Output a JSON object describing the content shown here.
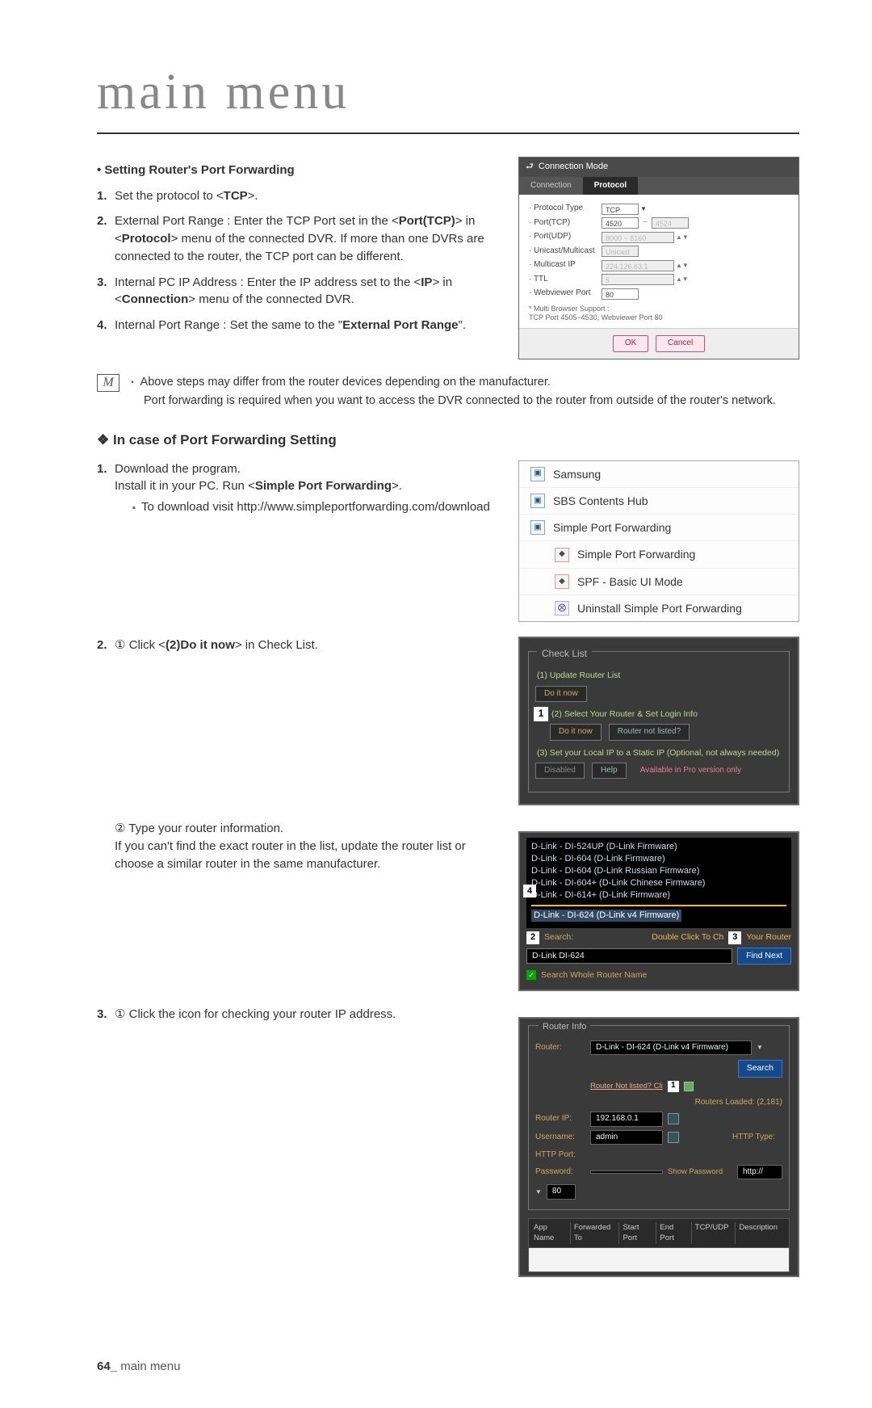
{
  "page": {
    "title": "main menu",
    "footer_page": "64_",
    "footer_text": "main menu"
  },
  "sec1": {
    "heading": "Setting Router's Port Forwarding",
    "steps": [
      {
        "n": "1.",
        "pre": "Set the protocol to <",
        "b": "TCP",
        "post": ">."
      },
      {
        "n": "2.",
        "text": "External Port Range : Enter the TCP Port set in the <",
        "b1": "Port(TCP)",
        "mid": "> in <",
        "b2": "Protocol",
        "post": "> menu of the connected DVR. If more than one DVRs are connected to the router, the TCP port can be different."
      },
      {
        "n": "3.",
        "text": "Internal PC IP Address : Enter the IP address set to the <",
        "b1": "IP",
        "mid": "> in <",
        "b2": "Connection",
        "post": "> menu of the connected DVR."
      },
      {
        "n": "4.",
        "text": "Internal Port Range : Set the same to the \"",
        "b1": "External Port Range",
        "post": "\"."
      }
    ],
    "note_line1": "Above steps may differ from the router devices depending on the manufacturer.",
    "note_line2": "Port forwarding is required when you want to access the DVR connected to the router from outside of the router's network."
  },
  "dialog": {
    "title": "Connection Mode",
    "tabs": {
      "a": "Connection",
      "b": "Protocol"
    },
    "rows": {
      "ptype": {
        "lbl": "Protocol Type",
        "val": "TCP"
      },
      "ptcp": {
        "lbl": "Port(TCP)",
        "a": "4520",
        "b": "4524"
      },
      "pudp": {
        "lbl": "Port(UDP)",
        "a": "8000 ~ 8160"
      },
      "um": {
        "lbl": "Unicast/Multicast",
        "val": "Unicast"
      },
      "mip": {
        "lbl": "Multicast IP",
        "val": "224.126.63.1"
      },
      "ttl": {
        "lbl": "TTL",
        "val": "5"
      },
      "wvp": {
        "lbl": "Webviewer Port",
        "val": "80"
      }
    },
    "note": "* Multi Browser Support :\n   TCP Port 4505~4530, Webviewer Port 80",
    "ok": "OK",
    "cancel": "Cancel"
  },
  "sec2": {
    "heading": "In case of Port Forwarding Setting",
    "s1_n": "1.",
    "s1_a": "Download the program.",
    "s1_b_pre": "Install it in your PC. Run <",
    "s1_b_bold": "Simple Port Forwarding",
    "s1_b_post": ">.",
    "s1_sub": "To download visit http://www.simpleportforwarding.com/download",
    "s2_n": "2.",
    "s2_a_pre": "① Click <",
    "s2_a_bold": "(2)Do it now",
    "s2_a_post": "> in Check List.",
    "s2_b": "② Type your router information.",
    "s2_c": "If you can't find the exact router in the list, update the router list or choose a similar router in the same manufacturer.",
    "s3_n": "3.",
    "s3_a": "① Click the icon for checking your router IP address."
  },
  "menu": {
    "items": [
      {
        "label": "Samsung",
        "icon": "folder"
      },
      {
        "label": "SBS Contents Hub",
        "icon": "folder"
      },
      {
        "label": "Simple Port Forwarding",
        "icon": "folder"
      },
      {
        "label": "Simple Port Forwarding",
        "icon": "spf",
        "indent": true
      },
      {
        "label": "SPF - Basic UI Mode",
        "icon": "spf",
        "indent": true
      },
      {
        "label": "Uninstall Simple Port Forwarding",
        "icon": "un",
        "indent": true
      }
    ]
  },
  "checklist": {
    "legend": "Check List",
    "l1": "(1) Update Router List",
    "b1": "Do it now",
    "l2": "(2) Select Your Router & Set Login Info",
    "b2a": "Do it now",
    "b2b": "Router not listed?",
    "l3": "(3) Set your Local IP to a Static IP (Optional, not always needed)",
    "b3a": "Disabled",
    "b3b": "Help",
    "b3c": "Available in Pro version only"
  },
  "routersel": {
    "items": [
      "D-Link - DI-524UP (D-Link Firmware)",
      "D-Link - DI-604 (D-Link Firmware)",
      "D-Link - DI-604 (D-Link Russian Firmware)",
      "D-Link - DI-604+ (D-Link Chinese Firmware)",
      "D-Link - DI-614+ (D-Link Firmware)"
    ],
    "selected": "D-Link - DI-624 (D-Link v4 Firmware)",
    "search_lbl": "Search:",
    "search_val": "D-Link DI-624",
    "dbl": "Double Click To Ch",
    "your_router": "Your Router",
    "find": "Find Next",
    "chk": "Search Whole Router Name"
  },
  "routerinfo": {
    "legend": "Router Info",
    "router_lbl": "Router:",
    "router_val": "D-Link - DI-624 (D-Link v4 Firmware)",
    "search": "Search",
    "notlisted": "Router Not listed? Cli",
    "loaded": "Routers Loaded: (2,181)",
    "ip_lbl": "Router IP:",
    "ip_val": "192.168.0.1",
    "user_lbl": "Username:",
    "user_val": "admin",
    "pass_lbl": "Password:",
    "show": "Show Password",
    "httptype_lbl": "HTTP Type:",
    "httptype_val": "http://",
    "httpport_lbl": "HTTP Port:",
    "httpport_val": "80",
    "cols": [
      "App Name",
      "Forwarded To",
      "Start Port",
      "End Port",
      "TCP/UDP",
      "Description"
    ]
  }
}
